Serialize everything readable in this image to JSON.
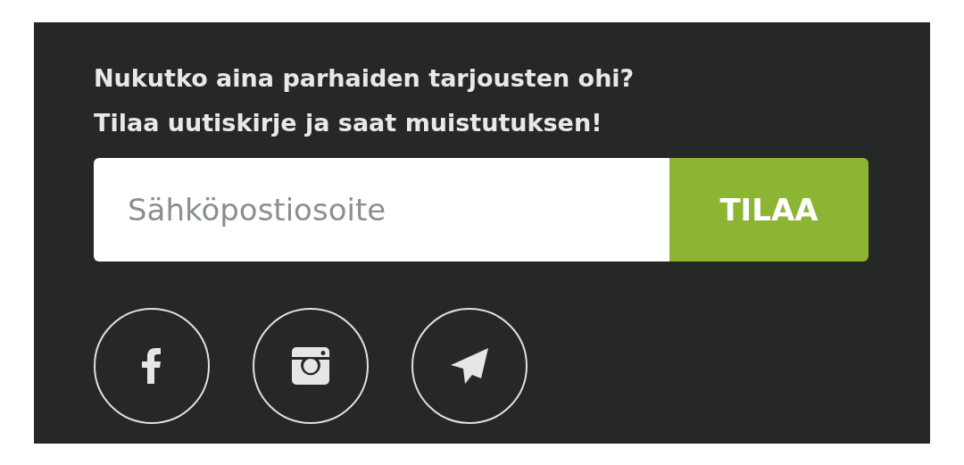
{
  "newsletter": {
    "heading_lines": [
      "Nukutko aina parhaiden tarjousten ohi?",
      "Tilaa uutiskirje ja saat muistutuksen!"
    ],
    "email_field": {
      "placeholder": "Sähköpostiosoite"
    },
    "subscribe_button": "TILAA"
  },
  "social_links": [
    {
      "kind": "facebook"
    },
    {
      "kind": "instagram"
    },
    {
      "kind": "send"
    }
  ]
}
